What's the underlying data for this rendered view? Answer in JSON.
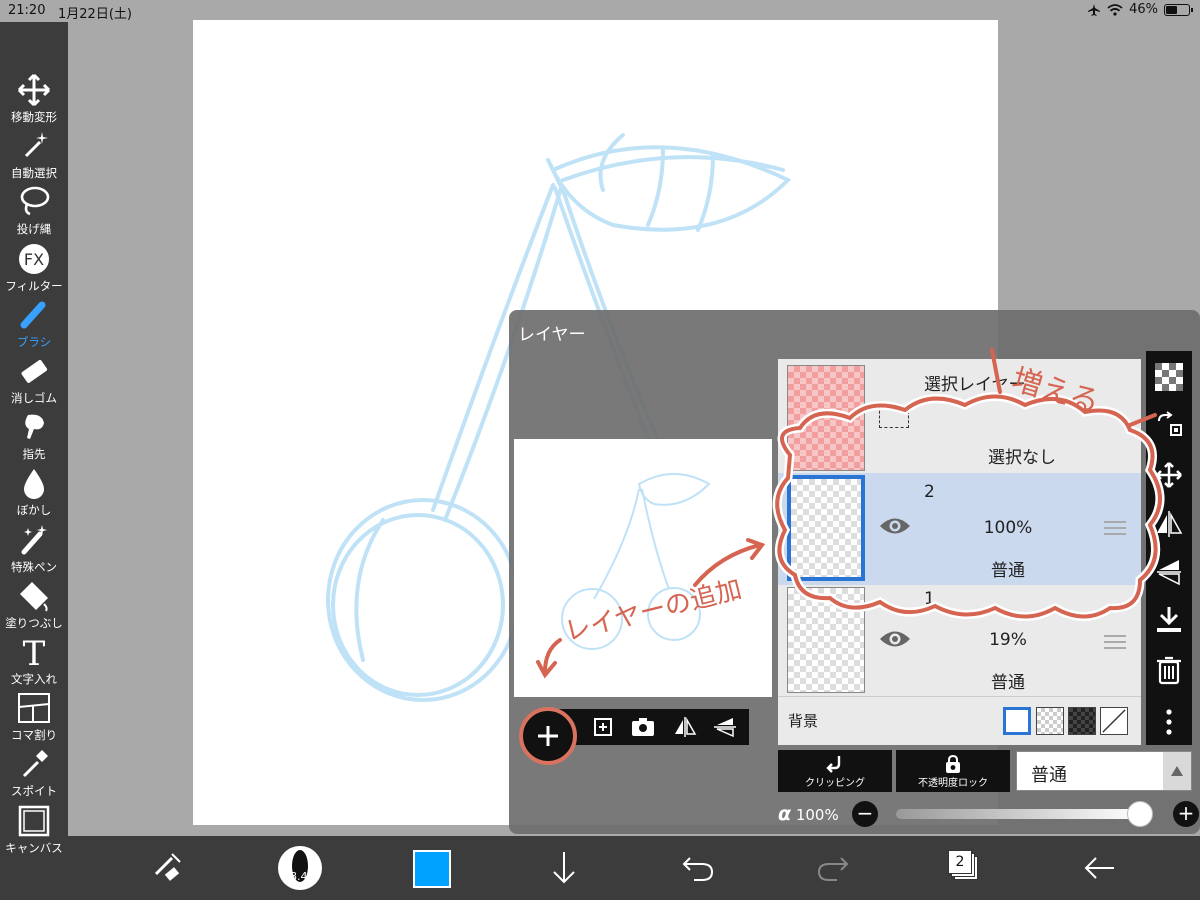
{
  "status_bar": {
    "time": "21:20",
    "date": "1月22日(土)",
    "battery": "46%"
  },
  "tools": [
    {
      "label": "移動変形",
      "icon": "move-icon"
    },
    {
      "label": "自動選択",
      "icon": "magic-wand-icon"
    },
    {
      "label": "投げ縄",
      "icon": "lasso-icon"
    },
    {
      "label": "フィルター",
      "icon": "fx-icon",
      "glyph": "FX"
    },
    {
      "label": "ブラシ",
      "icon": "brush-icon",
      "active": true
    },
    {
      "label": "消しゴム",
      "icon": "eraser-icon"
    },
    {
      "label": "指先",
      "icon": "finger-icon"
    },
    {
      "label": "ぼかし",
      "icon": "blur-icon"
    },
    {
      "label": "特殊ペン",
      "icon": "special-pen-icon"
    },
    {
      "label": "塗りつぶし",
      "icon": "fill-icon"
    },
    {
      "label": "文字入れ",
      "icon": "text-icon",
      "glyph": "T"
    },
    {
      "label": "コマ割り",
      "icon": "frame-divide-icon"
    },
    {
      "label": "スポイト",
      "icon": "eyedropper-icon"
    },
    {
      "label": "キャンバス",
      "icon": "canvas-icon"
    }
  ],
  "bottom_bar": {
    "brush_size": "8.4",
    "color": "#00a2ff",
    "layer_count": "2"
  },
  "layer_panel": {
    "title": "レイヤー",
    "selection_layer": {
      "name": "選択レイヤー",
      "status": "選択なし"
    },
    "layers": [
      {
        "name": "2",
        "opacity": "100%",
        "blend": "普通",
        "selected": true
      },
      {
        "name": "1",
        "opacity": "19%",
        "blend": "普通",
        "selected": false
      }
    ],
    "background_label": "背景",
    "clipping_label": "クリッピング",
    "alpha_lock_label": "不透明度ロック",
    "blend_mode": "普通",
    "opacity_label": "α",
    "opacity_value": "100%",
    "opacity_level": 1.0
  },
  "annotations": {
    "add_layer": "レイヤーの追加",
    "increases": "増える"
  },
  "colors": {
    "accent": "#38a0ff",
    "annotation": "#d56451",
    "sketch": "#bfe2f7",
    "selected_row": "#cbd9ef"
  }
}
